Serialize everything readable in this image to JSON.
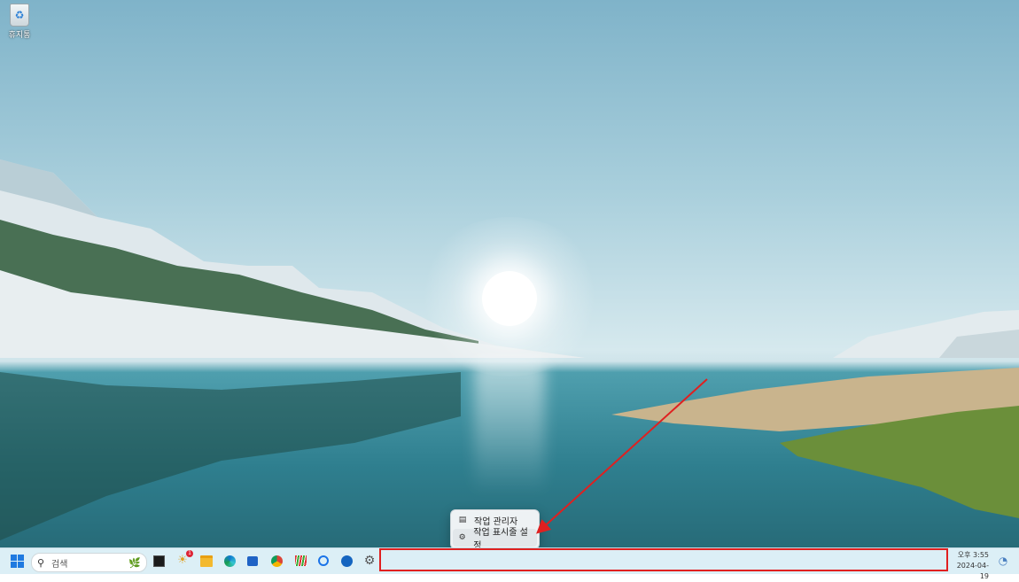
{
  "desktop": {
    "icons": [
      {
        "label": "휴지통",
        "icon": "recycle-bin-icon"
      }
    ]
  },
  "context_menu": {
    "items": [
      {
        "label": "작업 관리자",
        "icon": "task-manager-icon"
      },
      {
        "label": "작업 표시줄 설정",
        "icon": "gear-icon"
      }
    ]
  },
  "taskbar": {
    "search": {
      "placeholder": "검색"
    },
    "apps": [
      {
        "name": "start-button",
        "icon": "windows-logo-icon"
      },
      {
        "name": "terminal",
        "icon": "terminal-icon"
      },
      {
        "name": "widgets-notification",
        "icon": "widgets-icon",
        "badge": "1"
      },
      {
        "name": "file-explorer",
        "icon": "folder-icon"
      },
      {
        "name": "edge",
        "icon": "edge-browser-icon"
      },
      {
        "name": "store",
        "icon": "store-icon"
      },
      {
        "name": "chrome",
        "icon": "chrome-icon"
      },
      {
        "name": "app-stripes",
        "icon": "stripes-app-icon"
      },
      {
        "name": "copilot",
        "icon": "copilot-icon"
      },
      {
        "name": "app-blue",
        "icon": "blue-app-icon"
      },
      {
        "name": "settings",
        "icon": "settings-gear-icon"
      }
    ],
    "clock": {
      "time": "오후 3:55",
      "date": "2024-04-19"
    }
  },
  "colors": {
    "annotation": "#e02020",
    "accent": "#1f7ae0",
    "taskbar_bg": "#dceff6"
  }
}
